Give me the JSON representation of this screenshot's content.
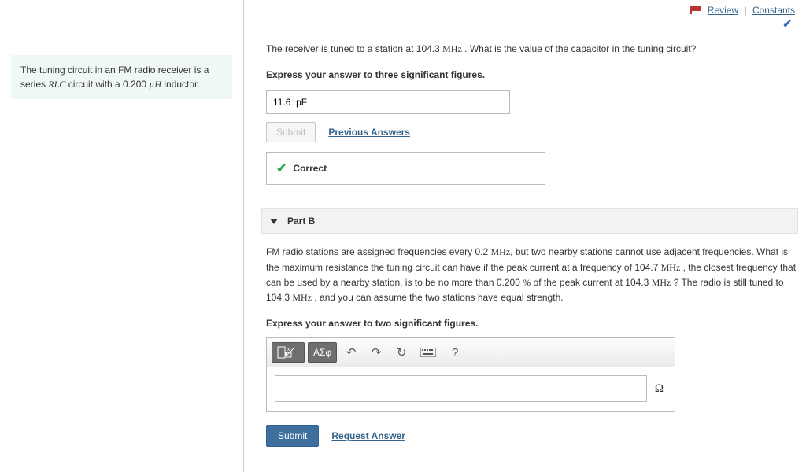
{
  "topbar": {
    "review": "Review",
    "constants": "Constants"
  },
  "intro": {
    "text_before": "The tuning circuit in an FM radio receiver is a series ",
    "rlc": "RLC",
    "text_mid": " circuit with a 0.200 ",
    "unit": "µH",
    "text_after": " inductor."
  },
  "partA": {
    "q_before": "The receiver is tuned to a station at 104.3 ",
    "mhz": "MHz",
    "q_after": " . What is the value of the capacitor in the tuning circuit?",
    "instr": "Express your answer to three significant figures.",
    "answer_value": "11.6  pF",
    "submit": "Submit",
    "prev": "Previous Answers",
    "feedback": "Correct"
  },
  "partB": {
    "header": "Part B",
    "q1": "FM radio stations are assigned frequencies every 0.2 ",
    "mhz": "MHz",
    "q2": ", but two nearby stations cannot use adjacent frequencies. What is the maximum resistance the tuning circuit can have if the peak current at a frequency of 104.7 ",
    "q3": " , the closest frequency that can be used by a nearby station, is to be no more than 0.200 ",
    "pct": "%",
    "q4": " of the peak current at 104.3 ",
    "q5": " ? The radio is still tuned to 104.3 ",
    "q6": " , and you can assume the two stations have equal strength.",
    "instr": "Express your answer to two significant figures.",
    "greek": "ΑΣφ",
    "unit": "Ω",
    "submit": "Submit",
    "request": "Request Answer",
    "help": "?"
  }
}
